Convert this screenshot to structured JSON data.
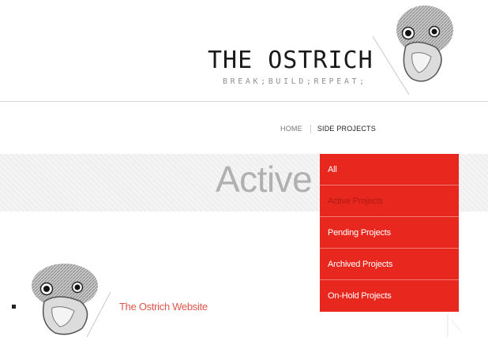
{
  "header": {
    "title": "THE OSTRICH",
    "tagline": "BREAK;BUILD;REPEAT;",
    "logo_icon": "ostrich-head-icon"
  },
  "nav": {
    "items": [
      {
        "label": "HOME",
        "active": false
      },
      {
        "label": "SIDE PROJECTS",
        "active": true
      }
    ]
  },
  "banner": {
    "title": "Active"
  },
  "dropdown": {
    "items": [
      {
        "label": "All",
        "selected": false
      },
      {
        "label": "Active Projects",
        "selected": true
      },
      {
        "label": "Pending Projects",
        "selected": false
      },
      {
        "label": "Archived Projects",
        "selected": false
      },
      {
        "label": "On-Hold Projects",
        "selected": false
      }
    ]
  },
  "projects": [
    {
      "name": "The Ostrich Website",
      "thumbnail_icon": "ostrich-head-icon"
    }
  ],
  "colors": {
    "accent": "#e8281f",
    "link": "#e0554a",
    "text": "#1a1a1a",
    "muted": "#8f8f8f"
  }
}
